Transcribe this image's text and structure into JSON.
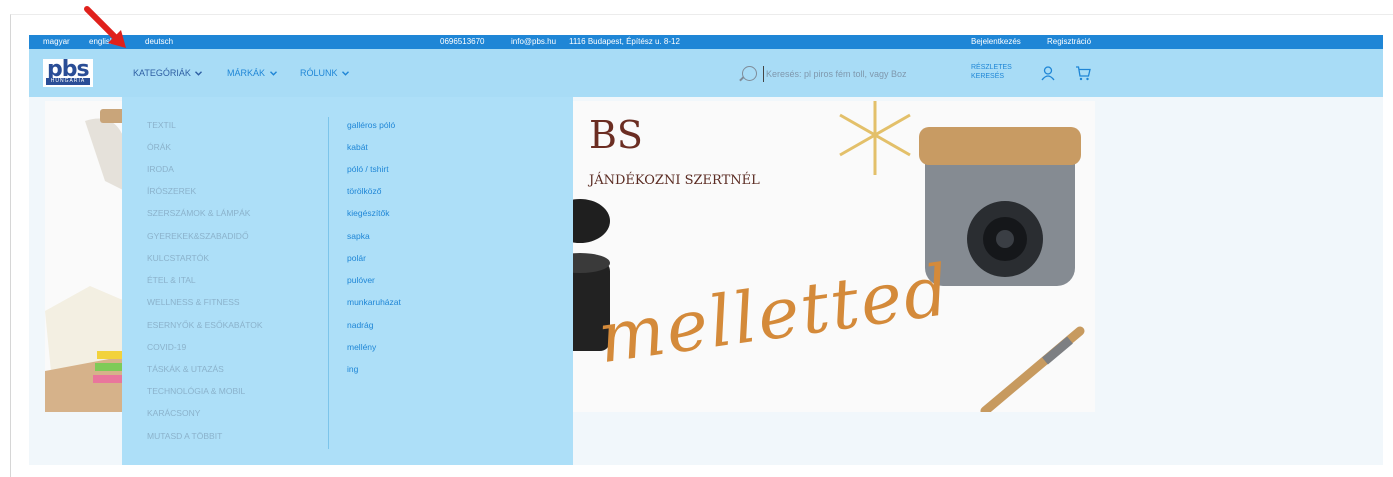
{
  "topbar": {
    "languages": [
      "magyar",
      "english",
      "deutsch"
    ],
    "phone": "0696513670",
    "email": "info@pbs.hu",
    "address": "1116 Budapest, Építész u. 8-12",
    "login": "Bejelentkezés",
    "register": "Regisztráció"
  },
  "logo": {
    "text": "pbs",
    "subtext": "HUNGARIA"
  },
  "nav": {
    "categories": "KATEGÓRIÁK",
    "brands": "MÁRKÁK",
    "about": "RÓLUNK"
  },
  "search": {
    "placeholder": "Keresés: pl piros fém toll, vagy Boz"
  },
  "detailed_search": {
    "line1": "RÉSZLETES",
    "line2": "KERESÉS"
  },
  "icons": {
    "search": "search-icon",
    "user": "user-icon",
    "cart": "cart-icon",
    "chevron": "chevron-down-icon",
    "arrow": "red-arrow-annotation"
  },
  "colors": {
    "topbar": "#1f86d6",
    "nav": "#a8dcf6",
    "dropdown": "#addff8",
    "link": "#1f86d6",
    "annotation": "#e0211c"
  },
  "dropdown": {
    "categories": [
      "TEXTIL",
      "ÓRÁK",
      "IRODA",
      "ÍRÓSZEREK",
      "SZERSZÁMOK & LÁMPÁK",
      "GYEREKEK&SZABADIDŐ",
      "KULCSTARTÓK",
      "ÉTEL & ITAL",
      "WELLNESS & FITNESS",
      "ESERNYŐK & ESŐKABÁTOK",
      "COVID-19",
      "TÁSKÁK & UTAZÁS",
      "TECHNOLÓGIA & MOBIL",
      "KARÁCSONY",
      "MUTASD A TÖBBIT"
    ],
    "subcategories": [
      "galléros póló",
      "kabát",
      "póló / tshirt",
      "törölköző",
      "kiegészítők",
      "sapka",
      "polár",
      "pulóver",
      "munkaruházat",
      "nadrág",
      "mellény",
      "ing"
    ]
  },
  "banner": {
    "title": "BS",
    "subtitle": "JÁNDÉKOZNI SZERTNÉL",
    "script": "melletted"
  }
}
